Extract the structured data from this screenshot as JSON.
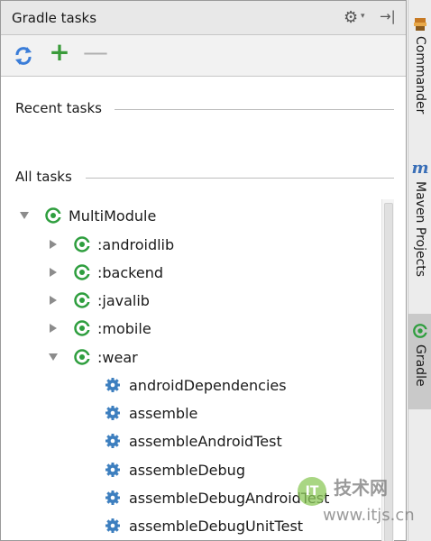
{
  "panel": {
    "title": "Gradle tasks"
  },
  "toolbar": {
    "refresh_icon": "refresh-icon",
    "add_icon": "plus-icon",
    "remove_icon": "minus-icon"
  },
  "sections": {
    "recent": "Recent tasks",
    "all": "All tasks"
  },
  "tree": {
    "root": {
      "label": "MultiModule",
      "expanded": true
    },
    "modules": [
      {
        "label": ":androidlib",
        "expanded": false
      },
      {
        "label": ":backend",
        "expanded": false
      },
      {
        "label": ":javalib",
        "expanded": false
      },
      {
        "label": ":mobile",
        "expanded": false
      },
      {
        "label": ":wear",
        "expanded": true
      }
    ],
    "tasks": [
      "androidDependencies",
      "assemble",
      "assembleAndroidTest",
      "assembleDebug",
      "assembleDebugAndroidTest",
      "assembleDebugUnitTest"
    ]
  },
  "sidebar": {
    "tabs": [
      {
        "label": "Commander",
        "icon": "commander-icon",
        "active": false
      },
      {
        "label": "Maven Projects",
        "icon": "maven-icon",
        "active": false
      },
      {
        "label": "Gradle",
        "icon": "gradle-icon",
        "active": true
      }
    ]
  },
  "watermark": {
    "logo": "IT",
    "line1": "技术网",
    "line2": "www.itjs.cn"
  },
  "colors": {
    "gradle_green": "#2e9e3e",
    "task_blue": "#3d7fbf",
    "refresh_blue": "#3b7dd8",
    "add_green": "#3a9b3a"
  }
}
